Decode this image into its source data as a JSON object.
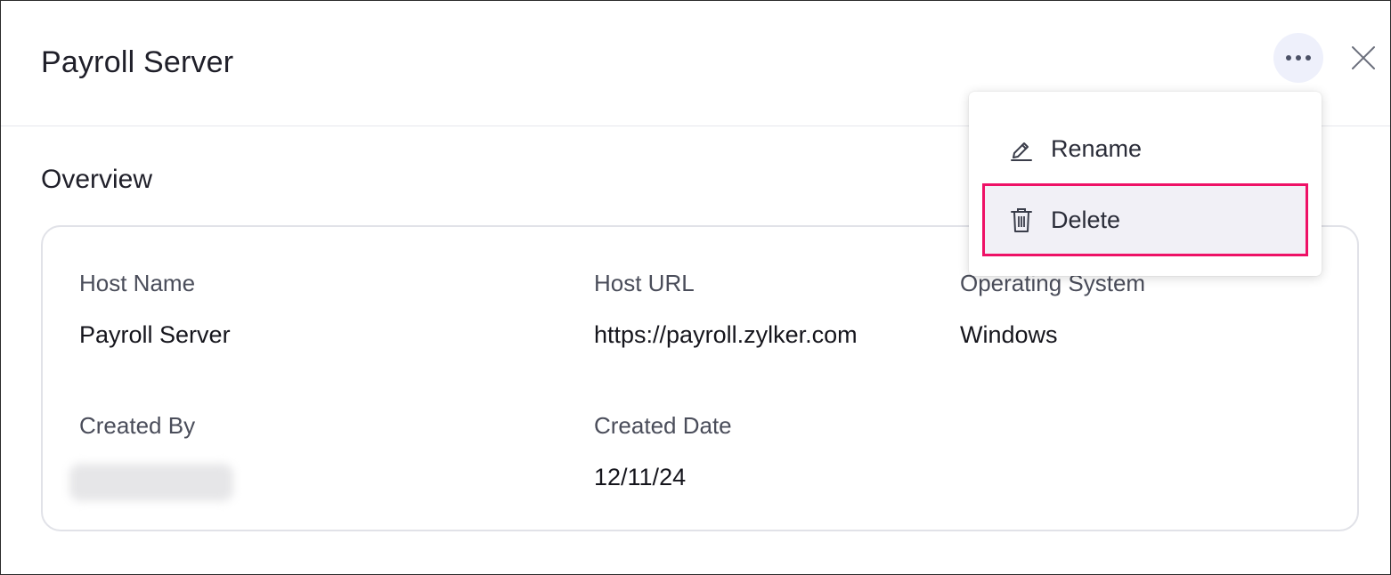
{
  "header": {
    "title": "Payroll Server",
    "more_icon": "more-horizontal-icon",
    "close_icon": "close-icon"
  },
  "overview": {
    "title": "Overview",
    "fields": {
      "host_name_label": "Host Name",
      "host_name_value": "Payroll Server",
      "host_url_label": "Host URL",
      "host_url_value": "https://payroll.zylker.com",
      "os_label": "Operating System",
      "os_value": "Windows",
      "created_by_label": "Created By",
      "created_date_label": "Created Date",
      "created_date_value": "12/11/24"
    }
  },
  "menu": {
    "items": [
      {
        "label": "Rename",
        "icon": "pencil-icon"
      },
      {
        "label": "Delete",
        "icon": "trash-icon",
        "highlighted": true
      }
    ],
    "highlight_color": "#ee1166"
  },
  "colors": {
    "accent_bg": "#eef0fb",
    "card_border": "#e1e2e8"
  }
}
